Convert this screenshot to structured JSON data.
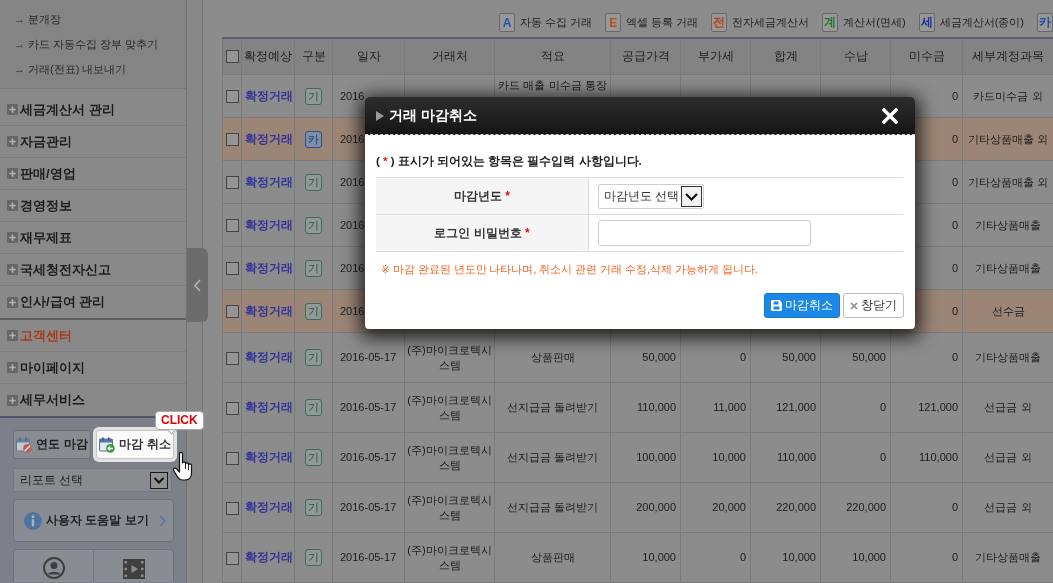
{
  "sidebar": {
    "links": [
      "→ 분개장",
      "→ 카드 자동수집 장부 맞추기",
      "→ 거래(전표) 내보내기"
    ],
    "menu_groups": [
      [
        {
          "label": "세금계산서 관리",
          "color": "#1c1c1c"
        },
        {
          "label": "자금관리",
          "color": "#1c1c1c"
        },
        {
          "label": "판매/영업",
          "color": "#1c1c1c"
        },
        {
          "label": "경영정보",
          "color": "#1c1c1c"
        },
        {
          "label": "재무제표",
          "color": "#1c1c1c"
        },
        {
          "label": "국세청전자신고",
          "color": "#1c1c1c"
        },
        {
          "label": "인사/급여 관리",
          "color": "#1c1c1c"
        }
      ],
      [
        {
          "label": "고객센터",
          "color": "#a8391b"
        },
        {
          "label": "마이페이지",
          "color": "#1c1c1c"
        },
        {
          "label": "세무서비스",
          "color": "#1c1c1c"
        }
      ]
    ],
    "close_buttons": [
      {
        "kind": "year-close",
        "label": "연도 마감",
        "highlighted": false
      },
      {
        "kind": "cancel-close",
        "label": "마감 취소",
        "highlighted": true,
        "callout": "CLICK"
      }
    ],
    "report_select": {
      "value": "리포트 선택"
    },
    "help_button": {
      "label": "사용자 도움말 보기"
    }
  },
  "legend": [
    {
      "mark": "A",
      "label": "자동 수집 거래",
      "color": "#1d55b0"
    },
    {
      "mark": "E",
      "label": "엑셀 등록 거래",
      "color": "#b5501a"
    },
    {
      "mark": "전",
      "label": "전자세금계산서",
      "color": "#b8401e"
    },
    {
      "mark": "계",
      "label": "계산서(면세)",
      "color": "#1f7a2e"
    },
    {
      "mark": "세",
      "label": "세금계산서(종이)",
      "color": "#1f2f9a"
    },
    {
      "mark": "카",
      "color": "#1f4aa5"
    }
  ],
  "table": {
    "header_checked": false,
    "columns": [
      "확정예상",
      "구분",
      "일자",
      "거래처",
      "적요",
      "공급가격",
      "부가세",
      "합계",
      "수납",
      "미수금",
      "세부계정과목"
    ],
    "rows": [
      {
        "checked": false,
        "highlighted": false,
        "status": "확정거래",
        "badge": "기",
        "kind": "general",
        "date": "2016",
        "memo": "카드 매출 미수금 통장",
        "unpaid": "0",
        "account": "카드미수금 외"
      },
      {
        "checked": false,
        "highlighted": true,
        "status": "확정거래",
        "badge": "카",
        "kind": "card",
        "date": "2016",
        "unpaid": "0",
        "account": "기타상품매출 외"
      },
      {
        "checked": false,
        "highlighted": false,
        "status": "확정거래",
        "badge": "기",
        "kind": "general",
        "date": "2016",
        "unpaid": "0",
        "account": "기타상품매출 외"
      },
      {
        "checked": false,
        "highlighted": false,
        "status": "확정거래",
        "badge": "기",
        "kind": "general",
        "date": "2016",
        "unpaid": "0",
        "account": "기타상품매출"
      },
      {
        "checked": false,
        "highlighted": false,
        "status": "확정거래",
        "badge": "기",
        "kind": "general",
        "date": "2016",
        "unpaid": "0",
        "account": "기타상품매출"
      },
      {
        "checked": false,
        "highlighted": true,
        "status": "확정거래",
        "badge": "기",
        "kind": "general",
        "date": "2016",
        "unpaid": "0",
        "account": "선수금"
      },
      {
        "checked": false,
        "highlighted": false,
        "status": "확정거래",
        "badge": "기",
        "kind": "general",
        "date": "2016-05-17",
        "partner": "(주)마이크로텍시스템",
        "memo": "상품판매",
        "supply": "50,000",
        "vat": "0",
        "total": "50,000",
        "received": "50,000",
        "unpaid": "0",
        "account": "기타상품매출"
      },
      {
        "checked": false,
        "highlighted": false,
        "status": "확정거래",
        "badge": "기",
        "kind": "general",
        "date": "2016-05-17",
        "partner": "(주)마이크로텍시스템",
        "memo": "선지급금 돌려받기",
        "supply": "110,000",
        "vat": "11,000",
        "total": "121,000",
        "received": "0",
        "unpaid": "121,000",
        "account": "선급금 외"
      },
      {
        "checked": false,
        "highlighted": false,
        "status": "확정거래",
        "badge": "기",
        "kind": "general",
        "date": "2016-05-17",
        "partner": "(주)마이크로텍시스템",
        "memo": "선지급금 돌려받기",
        "supply": "100,000",
        "vat": "10,000",
        "total": "110,000",
        "received": "0",
        "unpaid": "110,000",
        "account": "선급금 외"
      },
      {
        "checked": false,
        "highlighted": false,
        "status": "확정거래",
        "badge": "기",
        "kind": "general",
        "date": "2016-05-17",
        "partner": "(주)마이크로텍시스템",
        "memo": "선지급금 돌려받기",
        "supply": "200,000",
        "vat": "20,000",
        "total": "220,000",
        "received": "220,000",
        "unpaid": "0",
        "account": "선급금 외"
      },
      {
        "checked": false,
        "highlighted": false,
        "status": "확정거래",
        "badge": "기",
        "kind": "general",
        "date": "2016-05-17",
        "partner": "(주)마이크로텍시스템",
        "memo": "상품판매",
        "supply": "10,000",
        "vat": "0",
        "total": "10,000",
        "received": "10,000",
        "unpaid": "0",
        "account": "기타상품매출"
      }
    ]
  },
  "dialog": {
    "title": "거래 마감취소",
    "notice": {
      "before": "( ",
      "mark": "*",
      "after": " ) 표시가 되어있는 항목은 필수입력 사항입니다."
    },
    "fields": [
      {
        "kind": "select",
        "label": "마감년도",
        "mark": "*",
        "value": "마감년도 선택"
      },
      {
        "kind": "input",
        "label": "로그인 비밀번호",
        "mark": "*"
      }
    ],
    "note": "※ 마감 완료된 년도만 나타나며, 취소시 관련 거래 수정,삭제 가능하게 됩니다.",
    "buttons": [
      {
        "kind": "primary",
        "label": "마감취소"
      },
      {
        "kind": "secondary",
        "label": "창닫기"
      }
    ]
  }
}
